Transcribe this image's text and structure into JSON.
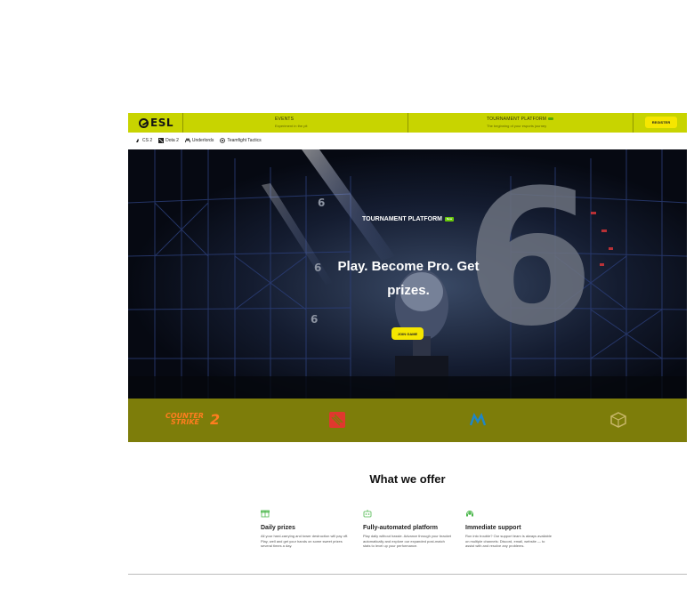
{
  "topbar": {
    "logo_text": "ESL",
    "events_title": "EVENTS",
    "events_sub": "Experiment in the pit",
    "platform_title": "TOURNAMENT PLATFORM",
    "platform_sub": "The beginning of your esports journey",
    "register_label": "REGISTER",
    "brand_color": "#c8d400"
  },
  "game_tabs": [
    {
      "label": "CS 2",
      "icon": "cs2-icon"
    },
    {
      "label": "Dota 2",
      "icon": "dota2-icon"
    },
    {
      "label": "Underlords",
      "icon": "underlords-icon"
    },
    {
      "label": "Teamfight Tactics",
      "icon": "tft-icon"
    }
  ],
  "hero": {
    "label": "TOURNAMENT PLATFORM",
    "badge": "New",
    "title": "Play. Become Pro. Get prizes.",
    "join_label": "JOIN GAME",
    "big_number": "6",
    "small_number": "6"
  },
  "strip": {
    "cs2_line1": "COUNTER",
    "cs2_line2": "STRIKE",
    "cs2_num": "2",
    "logos": [
      "counter-strike-2-logo",
      "dota2-logo",
      "underlords-logo",
      "tft-logo"
    ]
  },
  "offers": {
    "title": "What we offer",
    "items": [
      {
        "title": "Daily prizes",
        "desc": "All your hard-carrying and tower destruction will pay off. Play, well and get your hands on some sweet prizes several times a day.",
        "icon": "gift-icon"
      },
      {
        "title": "Fully-automated platform",
        "desc": "Play daily without hassle. Advance through your bracket automatically and explore our expanded post-match stats to level up your performance.",
        "icon": "robot-icon"
      },
      {
        "title": "Immediate support",
        "desc": "Run into trouble? Our support team is always available on multiple channels: Discord, email, website — to assist with and resolve any problems.",
        "icon": "headset-icon"
      }
    ]
  }
}
